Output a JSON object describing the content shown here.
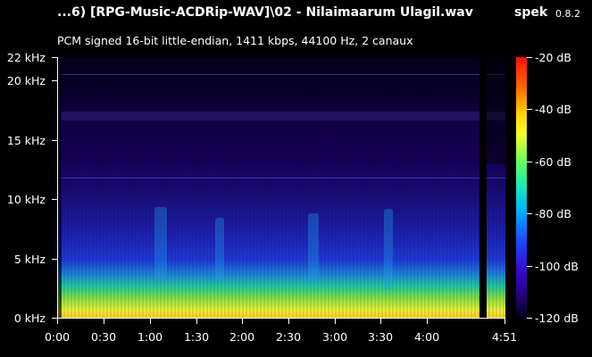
{
  "header": {
    "file_title": "...6) [RPG-Music-ACDRip-WAV]\\02 - Nilaimaarum Ulagil.wav",
    "app_name": "spek",
    "app_version": "0.8.2",
    "format_info": "PCM signed 16-bit little-endian, 1411 kbps, 44100 Hz, 2 canaux"
  },
  "frequency_axis": {
    "labels": [
      "22 kHz",
      "20 kHz",
      "15 kHz",
      "10 kHz",
      "5 kHz",
      "0 kHz"
    ]
  },
  "time_axis": {
    "labels": [
      "0:00",
      "0:30",
      "1:00",
      "1:30",
      "2:00",
      "2:30",
      "3:00",
      "3:30",
      "4:00",
      "4:51"
    ]
  },
  "colorbar": {
    "labels": [
      "-20 dB",
      "-40 dB",
      "-60 dB",
      "-80 dB",
      "-100 dB",
      "-120 dB"
    ]
  },
  "colors": {
    "background": "#000000",
    "text": "#ffffff"
  }
}
